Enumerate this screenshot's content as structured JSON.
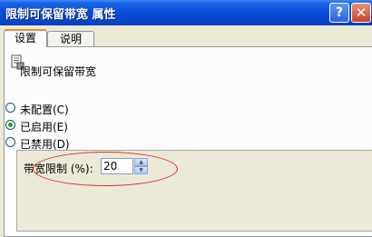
{
  "window": {
    "title": "限制可保留带宽 属性",
    "help_glyph": "?",
    "close_glyph": "✕"
  },
  "tabs": [
    {
      "label": "设置",
      "active": true
    },
    {
      "label": "说明",
      "active": false
    }
  ],
  "policy": {
    "name": "限制可保留带宽",
    "icon": "policy-setting-icon"
  },
  "options": [
    {
      "label": "未配置(C)",
      "checked": false
    },
    {
      "label": "已启用(E)",
      "checked": true
    },
    {
      "label": "已禁用(D)",
      "checked": false
    }
  ],
  "bandwidth": {
    "label": "带宽限制 (%):",
    "value": "20"
  },
  "colors": {
    "titlebar": "#0a4fd9",
    "annotation": "#d0312d",
    "radio_dot": "#21a121"
  }
}
